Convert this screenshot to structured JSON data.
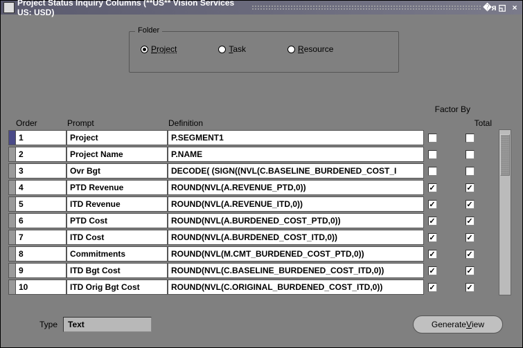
{
  "window": {
    "title": "Project Status Inquiry Columns (**US** Vision Services US: USD)"
  },
  "folder": {
    "legend": "Folder",
    "options": {
      "project": "Project",
      "task": "Task",
      "resource": "Resource"
    },
    "selected": "project"
  },
  "headers": {
    "order": "Order",
    "prompt": "Prompt",
    "definition": "Definition",
    "factor_by": "Factor By",
    "total": "Total"
  },
  "rows": [
    {
      "order": "1",
      "prompt": "Project",
      "definition": "P.SEGMENT1",
      "factor": false,
      "total": false,
      "current": true
    },
    {
      "order": "2",
      "prompt": "Project Name",
      "definition": "P.NAME",
      "factor": false,
      "total": false
    },
    {
      "order": "3",
      "prompt": "Ovr Bgt",
      "definition": "DECODE( (SIGN((NVL(C.BASELINE_BURDENED_COST_I",
      "factor": false,
      "total": false
    },
    {
      "order": "4",
      "prompt": "PTD Revenue",
      "definition": "ROUND(NVL(A.REVENUE_PTD,0))",
      "factor": true,
      "total": true
    },
    {
      "order": "5",
      "prompt": "ITD Revenue",
      "definition": "ROUND(NVL(A.REVENUE_ITD,0))",
      "factor": true,
      "total": true
    },
    {
      "order": "6",
      "prompt": "PTD Cost",
      "definition": "ROUND(NVL(A.BURDENED_COST_PTD,0))",
      "factor": true,
      "total": true
    },
    {
      "order": "7",
      "prompt": "ITD Cost",
      "definition": "ROUND(NVL(A.BURDENED_COST_ITD,0))",
      "factor": true,
      "total": true
    },
    {
      "order": "8",
      "prompt": "Commitments",
      "definition": "ROUND(NVL(M.CMT_BURDENED_COST_PTD,0))",
      "factor": true,
      "total": true
    },
    {
      "order": "9",
      "prompt": "ITD Bgt Cost",
      "definition": "ROUND(NVL(C.BASELINE_BURDENED_COST_ITD,0))",
      "factor": true,
      "total": true
    },
    {
      "order": "10",
      "prompt": "ITD Orig Bgt Cost",
      "definition": "ROUND(NVL(C.ORIGINAL_BURDENED_COST_ITD,0))",
      "factor": true,
      "total": true
    }
  ],
  "type": {
    "label": "Type",
    "value": "Text"
  },
  "buttons": {
    "generate_view": "Generate View"
  }
}
